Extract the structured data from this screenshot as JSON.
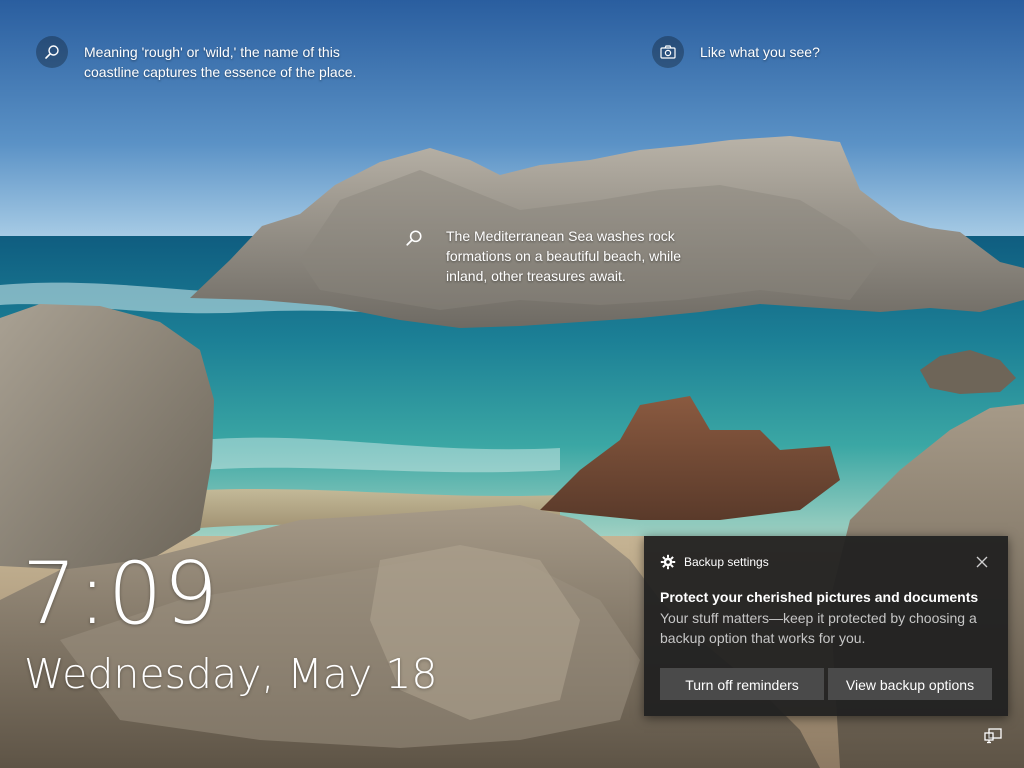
{
  "lockscreen": {
    "spotlight_top": {
      "text": "Meaning 'rough' or 'wild,' the name of this coastline captures the essence of the place.",
      "icon": "search-icon"
    },
    "spotlight_like": {
      "text": "Like what you see?",
      "icon": "camera-icon"
    },
    "spotlight_middle": {
      "text": "The Mediterranean Sea washes rock formations on a beautiful beach, while inland, other treasures await.",
      "icon": "search-icon"
    },
    "time": "7:09",
    "date": "Wednesday, May 18"
  },
  "toast": {
    "app_name": "Backup settings",
    "app_icon": "gear-icon",
    "title": "Protect your cherished pictures and documents",
    "body": "Your stuff matters—keep it protected by choosing a backup option that works for you.",
    "buttons": {
      "turn_off": "Turn off reminders",
      "view": "View backup options"
    },
    "close_icon": "close-icon"
  },
  "status": {
    "network_icon": "network-icon"
  },
  "colors": {
    "toast_bg": "#202020",
    "button_bg": "#4a4a4a",
    "text": "#ffffff",
    "body_text": "#c6c6c6"
  }
}
